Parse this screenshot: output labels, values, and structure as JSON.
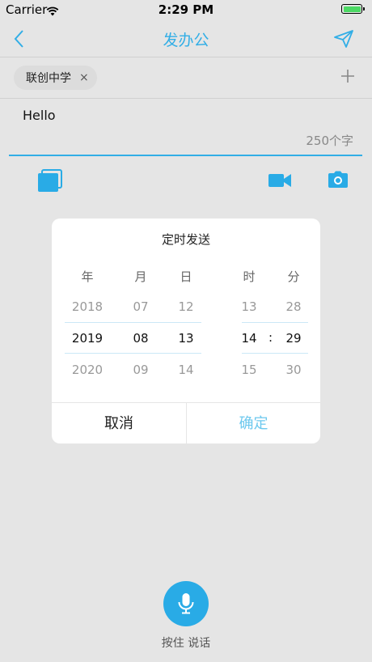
{
  "status": {
    "carrier": "Carrier",
    "time": "2:29 PM"
  },
  "nav": {
    "title": "发办公",
    "back_icon": "chevron-left-icon",
    "send_icon": "paper-plane-icon"
  },
  "recipients": [
    {
      "name": "联创中学",
      "remove_glyph": "×"
    }
  ],
  "compose": {
    "text": "Hello",
    "counter": "250个字"
  },
  "toolbar": {
    "icons": [
      "image-stack-icon",
      "video-camera-icon",
      "camera-icon"
    ]
  },
  "accent_color": "#32aee6",
  "picker": {
    "title": "定时发送",
    "headers": {
      "year": "年",
      "month": "月",
      "day": "日",
      "hour": "时",
      "minute": "分"
    },
    "year": [
      "2018",
      "2019",
      "2020"
    ],
    "month": [
      "07",
      "08",
      "09"
    ],
    "day": [
      "12",
      "13",
      "14"
    ],
    "hour": [
      "13",
      "14",
      "15"
    ],
    "minute": [
      "28",
      "29",
      "30"
    ],
    "separator": ":",
    "cancel": "取消",
    "confirm": "确定"
  },
  "voice": {
    "label": "按住 说话",
    "icon": "microphone-icon"
  }
}
